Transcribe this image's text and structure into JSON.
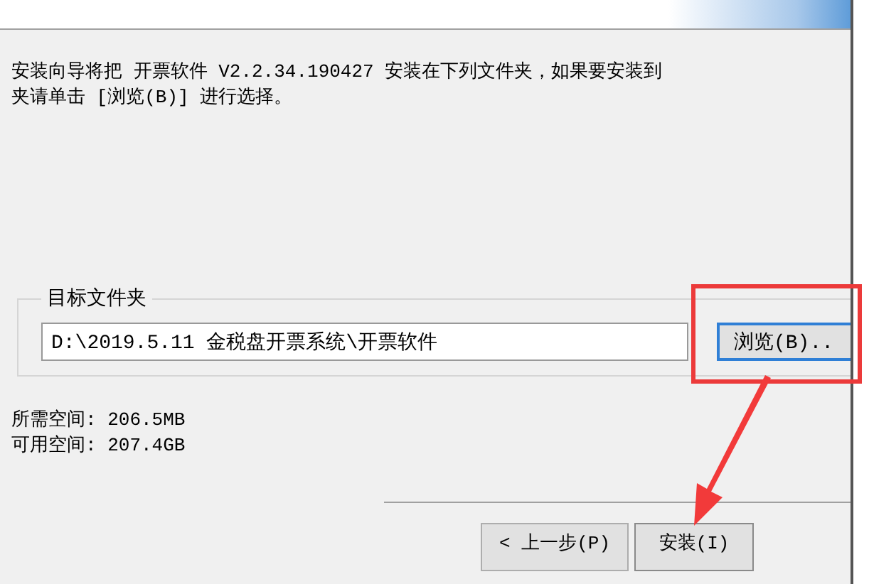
{
  "intro_lines": [
    "安装向导将把 开票软件 V2.2.34.190427 安装在下列文件夹，如果要安装到",
    "夹请单击 [浏览(B)] 进行选择。"
  ],
  "destination": {
    "label": "目标文件夹",
    "path": "D:\\2019.5.11 金税盘开票系统\\开票软件",
    "browse_button": "浏览(B).."
  },
  "space": [
    "所需空间: 206.5MB",
    "可用空间: 207.4GB"
  ],
  "buttons": [
    {
      "label": "< 上一步(P)",
      "kind": "back"
    },
    {
      "label": "安装(I)",
      "kind": "default"
    }
  ]
}
